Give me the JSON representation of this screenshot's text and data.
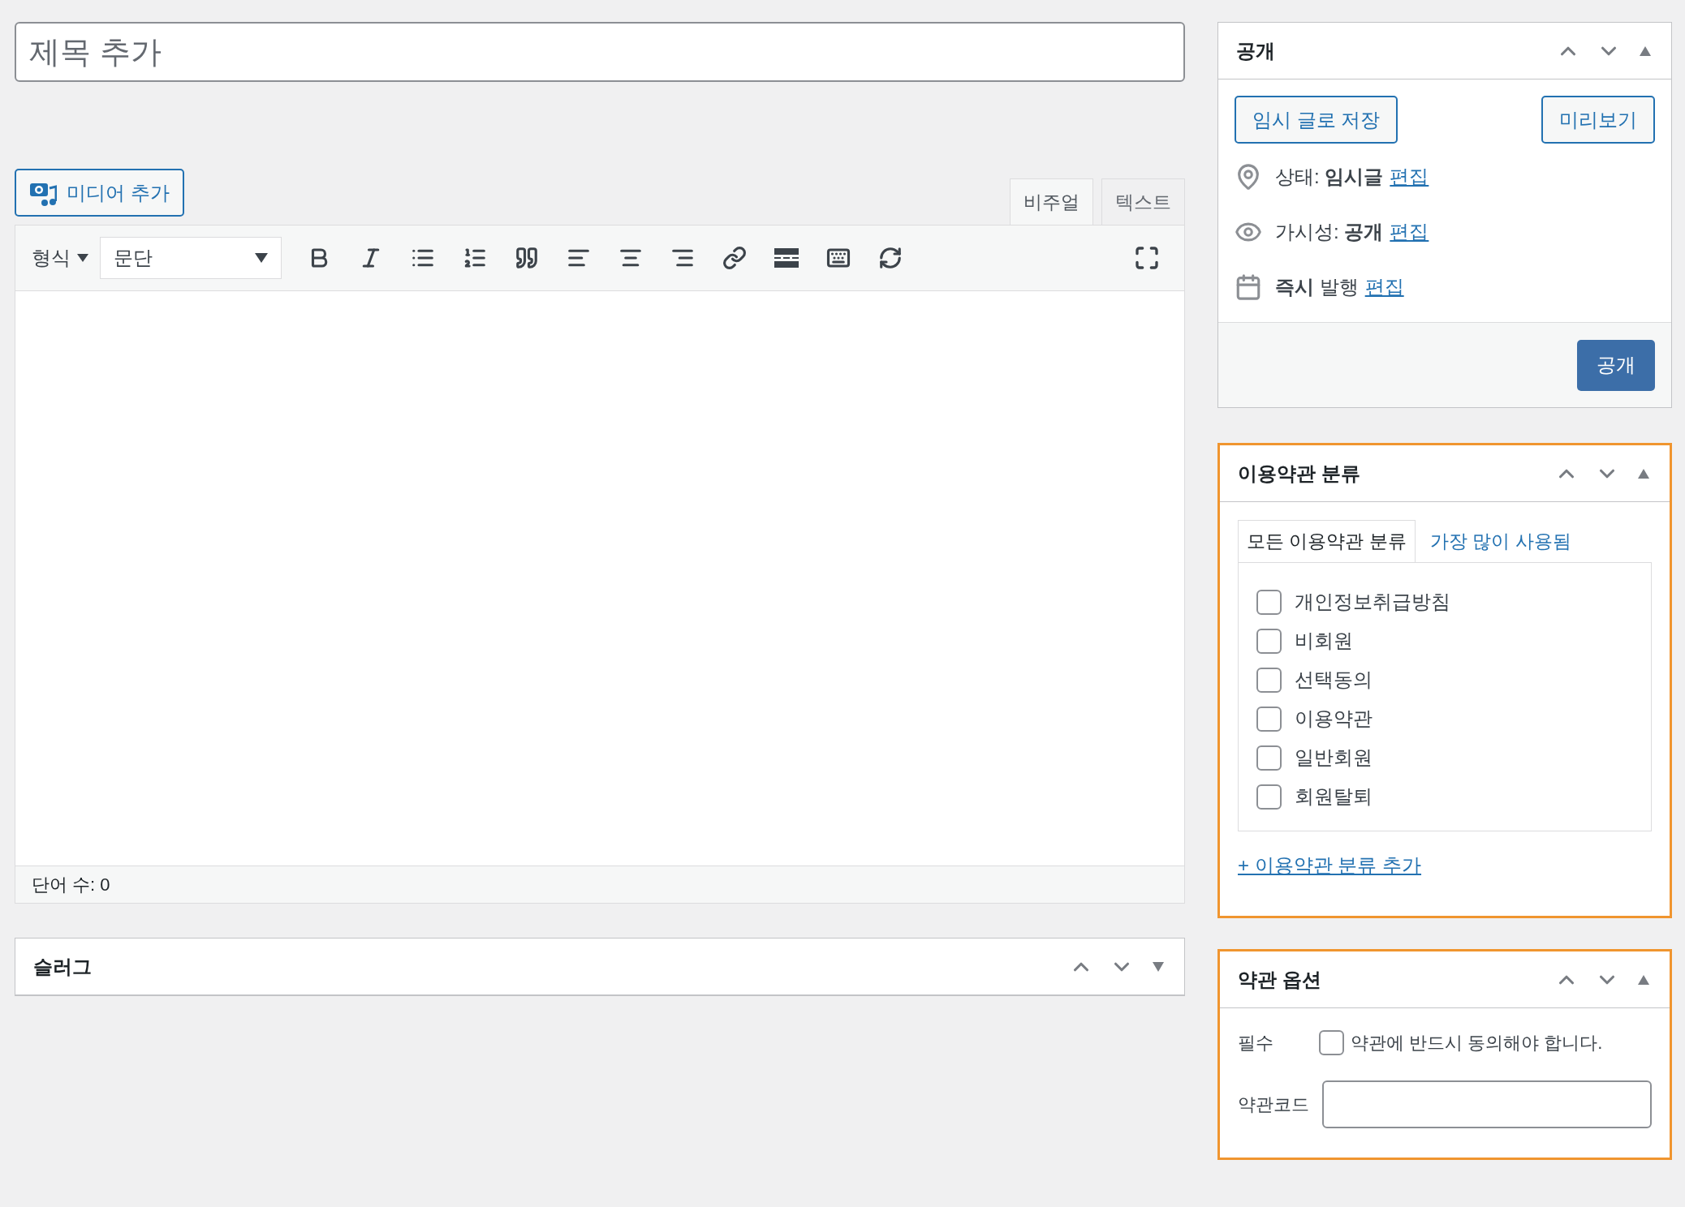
{
  "title_field": {
    "placeholder": "제목 추가"
  },
  "media_button": {
    "label": "미디어 추가"
  },
  "editor_tabs": [
    {
      "label": "비주얼",
      "selected": true
    },
    {
      "label": "텍스트",
      "selected": false
    }
  ],
  "toolbar": {
    "format_label": "형식",
    "paragraph_select": "문단"
  },
  "word_count": "단어 수: 0",
  "slug_box": {
    "title": "슬러그",
    "expanded": false,
    "highlighted": false
  },
  "publish_box": {
    "title": "공개",
    "expanded": true,
    "highlighted": false,
    "save_draft": "임시 글로 저장",
    "preview": "미리보기",
    "rows": [
      {
        "kind": "status",
        "text": "상태: **임시글**",
        "link": "편집"
      },
      {
        "kind": "visibility",
        "text": "가시성: **공개**",
        "link": "편집"
      },
      {
        "kind": "schedule",
        "text": "**즉시** 발행",
        "link": "편집"
      }
    ],
    "publish": "공개"
  },
  "taxonomy_box": {
    "title": "이용약관 분류",
    "expanded": true,
    "highlighted": true,
    "tabs": [
      {
        "label": "모든 이용약관 분류",
        "selected": true
      },
      {
        "label": "가장 많이 사용됨",
        "selected": false
      }
    ],
    "terms": [
      {
        "label": "개인정보취급방침",
        "checked": false
      },
      {
        "label": "비회원",
        "checked": false
      },
      {
        "label": "선택동의",
        "checked": false
      },
      {
        "label": "이용약관",
        "checked": false
      },
      {
        "label": "일반회원",
        "checked": false
      },
      {
        "label": "회원탈퇴",
        "checked": false
      }
    ],
    "add_link": "+ 이용약관 분류 추가"
  },
  "options_box": {
    "title": "약관 옵션",
    "expanded": true,
    "highlighted": true,
    "required_label": "필수",
    "required_checked": false,
    "required_text": "약관에 반드시 동의해야 합니다.",
    "code_label": "약관코드"
  }
}
